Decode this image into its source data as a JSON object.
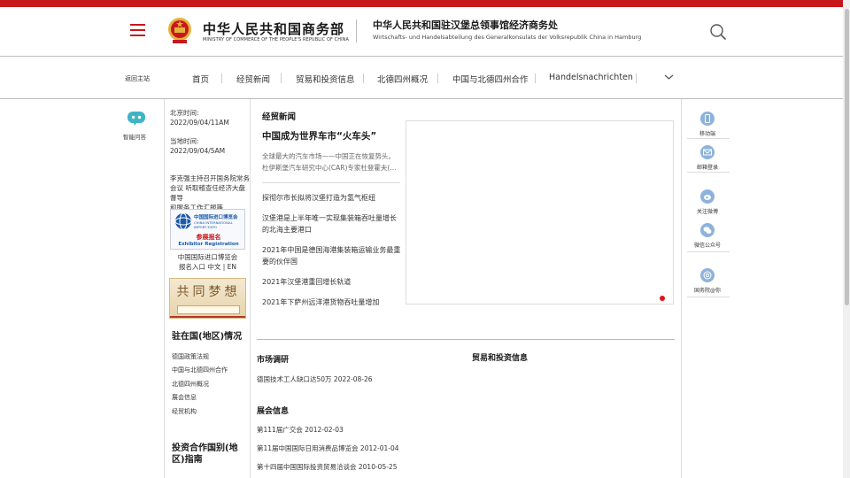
{
  "header": {
    "logo_cn": "中华人民共和国商务部",
    "logo_en": "MINISTRY OF COMMERCE OF THE PEOPLE'S REPUBLIC OF CHINA",
    "office_cn": "中华人民共和国驻汉堡总领事馆经济商务处",
    "office_de": "Wirtschafts- und Handelsabteilung des Generalkonsulats der Volksrepublik China in Hamburg"
  },
  "nav": {
    "back": "返回主站",
    "items": [
      "首页",
      "经贸新闻",
      "贸易和投资信息",
      "北德四州概况",
      "中国与北德四州合作",
      "Handelsnachrichten"
    ]
  },
  "left_rail": {
    "chat_label": "智能问答"
  },
  "info": {
    "beijing_label": "北京时间:",
    "beijing_time": "2022/09/04/11AM",
    "local_label": "当地时间:",
    "local_time": "2022/09/04/5AM",
    "notice": [
      "李克强主持召开国务院常务",
      "会议 听取稽查任经济大盘督导",
      "和服务工作汇报等"
    ],
    "ciie_title": "中国国际进口博览会",
    "ciie_en": "CHINA INTERNATIONAL IMPORT EXPO",
    "ciie_reg_cn": "参展报名",
    "ciie_reg_en": "Exhibitor Registration",
    "ciie_caption": [
      "中国国际进口博览会",
      "报名入口 中文 | EN"
    ],
    "dream_text": "共同梦想",
    "country_heading": "驻在国(地区)情况",
    "country_links": [
      "德国政策法规",
      "中国与北德四州合作",
      "北德四州概况",
      "展会信息",
      "经贸机构"
    ],
    "invest_heading": [
      "投资合作国别(地",
      "区)指南"
    ]
  },
  "news": {
    "section_title": "经贸新闻",
    "headline": "中国成为世界车市“火车头”",
    "summary": [
      "全球最大的汽车市场——中国正在恢复势头。",
      "杜伊斯堡汽车研究中心(CAR)专家杜登霍夫(..."
    ],
    "links": [
      [
        "探彻尔市长拟将汉堡打造为氢气枢纽"
      ],
      [
        "汉堡港是上半年唯一实现集装箱吞吐量增长",
        "的北海主要港口"
      ],
      [
        "2021年中国是德国海港集装箱运输业务最重",
        "要的伙伴国"
      ],
      [
        "2021年汉堡港重回增长轨道"
      ],
      [
        "2021年下萨州远洋港货物吞吐量增加"
      ]
    ]
  },
  "market": {
    "title": "市场调研",
    "items": [
      "德国技术工人缺口达50万 2022-08-26"
    ]
  },
  "trade_info": {
    "title": "贸易和投资信息"
  },
  "fairs": {
    "title": "展会信息",
    "items": [
      "第111届广交会 2012-02-03",
      "第11届中国国际日用消费品博览会 2012-01-04",
      "第十四届中国国际投资贸易洽谈会 2010-05-25"
    ]
  },
  "right_rail": {
    "items": [
      "移动端",
      "邮箱登录",
      "关注微博",
      "微信公众号",
      "国务院@你"
    ]
  },
  "colors": {
    "brand_red": "#c8161d",
    "icon_blue": "#8db3da"
  }
}
